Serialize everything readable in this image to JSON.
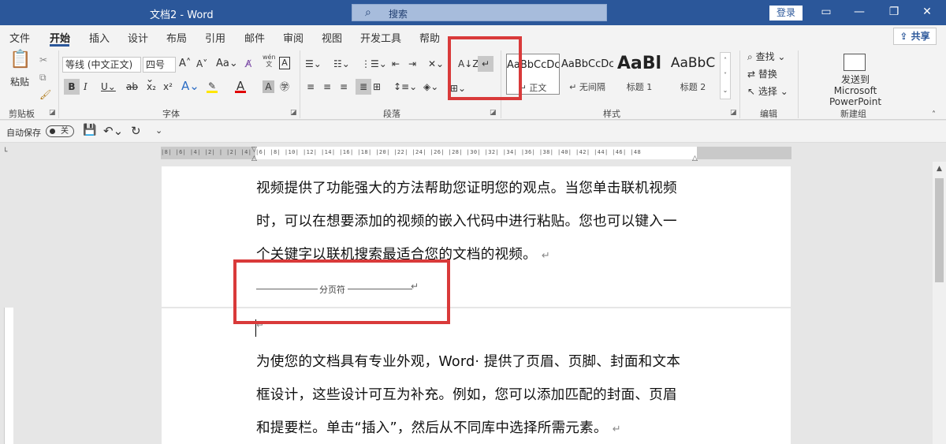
{
  "titlebar": {
    "doc_title": "文档2  -  Word",
    "search_placeholder": "搜索",
    "login_label": "登录"
  },
  "tabs": [
    {
      "label": "文件"
    },
    {
      "label": "开始"
    },
    {
      "label": "插入"
    },
    {
      "label": "设计"
    },
    {
      "label": "布局"
    },
    {
      "label": "引用"
    },
    {
      "label": "邮件"
    },
    {
      "label": "审阅"
    },
    {
      "label": "视图"
    },
    {
      "label": "开发工具"
    },
    {
      "label": "帮助"
    }
  ],
  "share_label": "共享",
  "ribbon": {
    "clipboard": {
      "paste_label": "粘贴",
      "group_label": "剪贴板"
    },
    "font": {
      "font_name": "等线 (中文正文)",
      "font_size": "四号",
      "group_label": "字体",
      "wen_label": "wén"
    },
    "paragraph": {
      "group_label": "段落"
    },
    "styles": {
      "group_label": "样式",
      "items": [
        {
          "preview": "AaBbCcDc",
          "name": "↵ 正文"
        },
        {
          "preview": "AaBbCcDc",
          "name": "↵ 无间隔"
        },
        {
          "preview": "AaBl",
          "name": "标题 1"
        },
        {
          "preview": "AaBbC",
          "name": "标题 2"
        }
      ]
    },
    "editing": {
      "find_label": "查找",
      "replace_label": "替换",
      "select_label": "选择",
      "group_label": "编辑"
    },
    "newgroup": {
      "send_label_1": "发送到",
      "send_label_2": "Microsoft PowerPoint",
      "group_label": "新建组"
    }
  },
  "qat": {
    "autosave_label": "自动保存",
    "toggle_label": "关"
  },
  "ruler": {
    "marks": "|8| |6| |4| |2|  |  |2| |4| |6| |8| |10| |12| |14| |16| |18| |20| |22| |24| |26| |28| |30| |32| |34| |36| |38| |40| |42| |44| |46| |48"
  },
  "document": {
    "page1_lines": [
      "视频提供了功能强大的方法帮助您证明您的观点。当您单击联机视频",
      "时，可以在想要添加的视频的嵌入代码中进行粘贴。您也可以键入一",
      "个关键字以联机搜索最适合您的文档的视频。"
    ],
    "page_break_label": "分页符",
    "page2_lines": [
      "为使您的文档具有专业外观，Word· 提供了页眉、页脚、封面和文本",
      "框设计，这些设计可互为补充。例如，您可以添加匹配的封面、页眉",
      "和提要栏。单击“插入”，然后从不同库中选择所需元素。"
    ],
    "paragraph_mark": "↵"
  },
  "colors": {
    "titlebar": "#2b579a",
    "highlight_box": "#d93a3a"
  }
}
